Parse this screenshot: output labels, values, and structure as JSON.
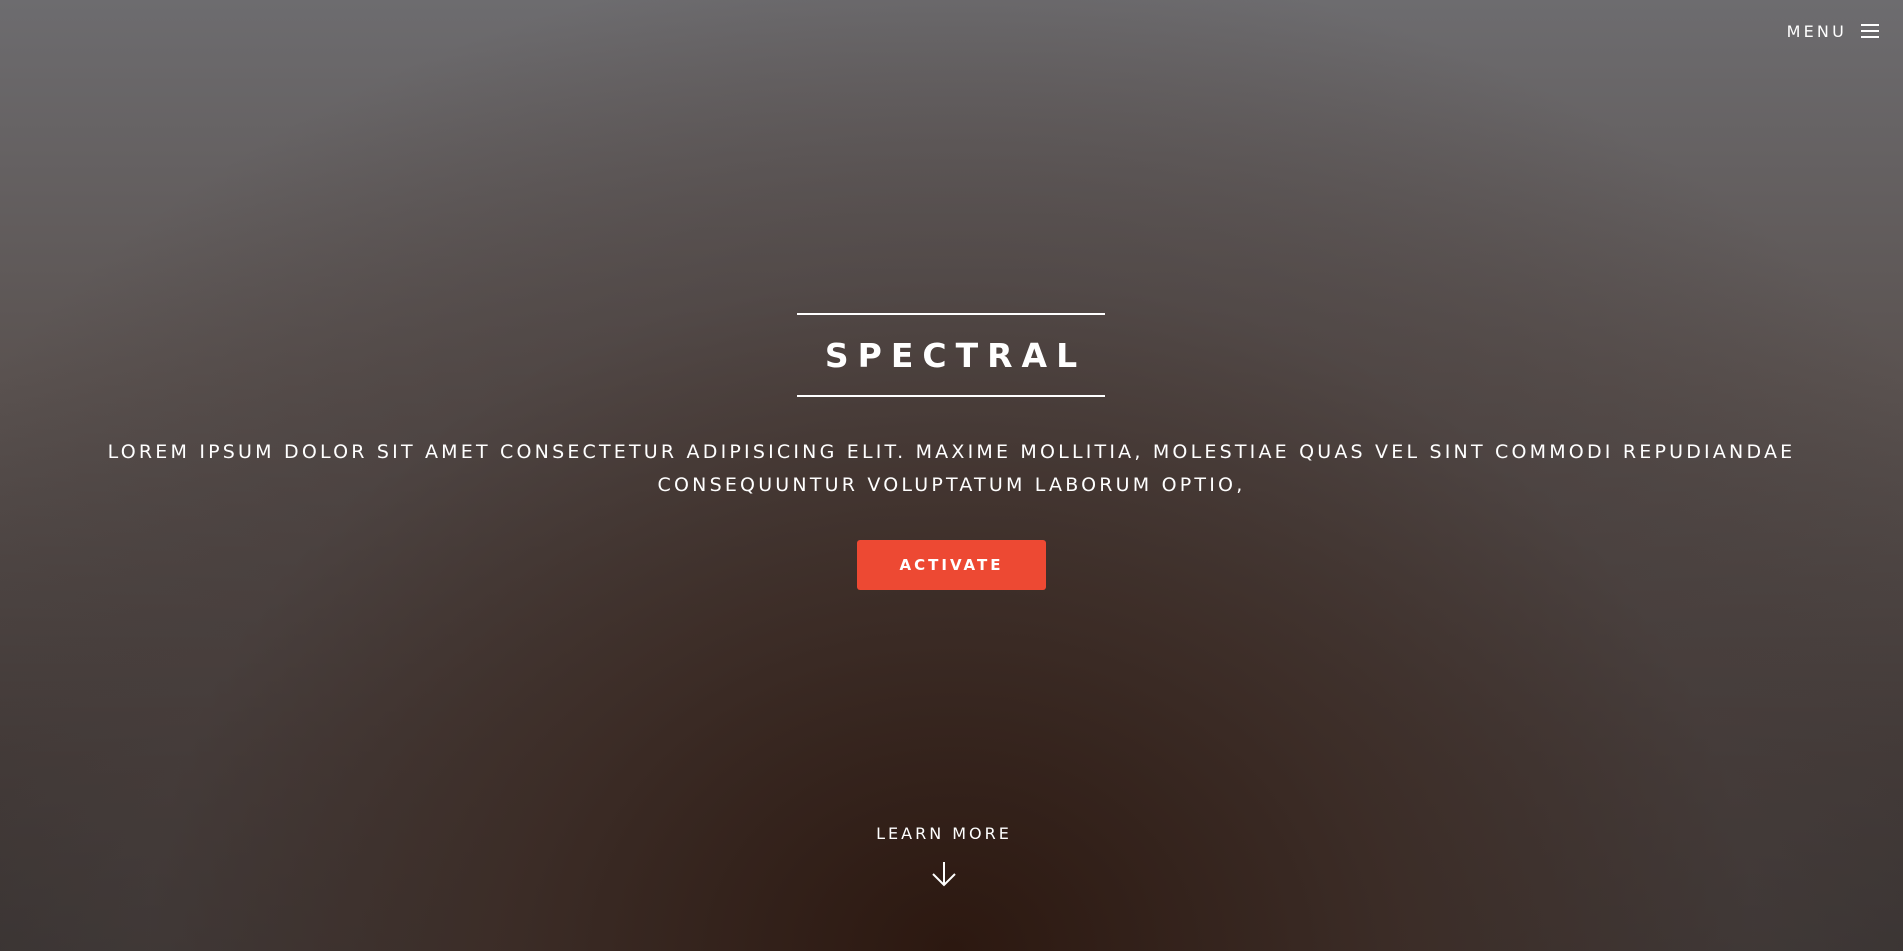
{
  "header": {
    "menu_label": "MENU",
    "menu_icon": "hamburger-icon"
  },
  "banner": {
    "title": "SPECTRAL",
    "subtitle": "LOREM IPSUM DOLOR SIT AMET CONSECTETUR ADIPISICING ELIT. MAXIME MOLLITIA, MOLESTIAE QUAS VEL SINT COMMODI REPUDIANDAE CONSEQUUNTUR VOLUPTATUM LABORUM OPTIO,",
    "activate_label": "ACTIVATE",
    "learn_more_label": "LEARN MORE",
    "learn_more_icon": "arrow-down-icon"
  },
  "colors": {
    "accent": "#ed4933",
    "text": "#ffffff"
  }
}
